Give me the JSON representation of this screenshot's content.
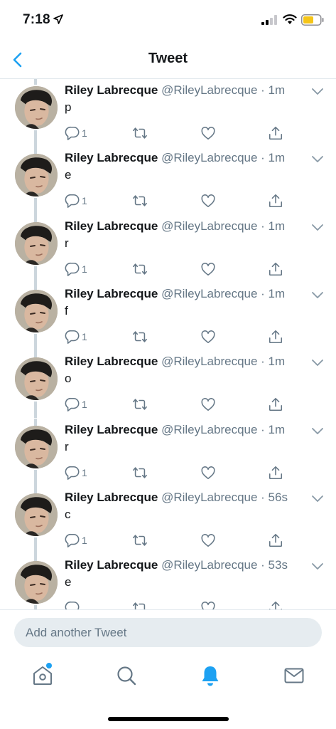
{
  "status_bar": {
    "time": "7:18",
    "icons": [
      "location-arrow-icon",
      "signal-icon",
      "wifi-icon",
      "battery-icon"
    ]
  },
  "header": {
    "title": "Tweet",
    "back_icon": "chevron-left-icon"
  },
  "colors": {
    "accent": "#1da1f2",
    "text_primary": "#14171a",
    "text_secondary": "#657786",
    "divider": "#e1e8ed",
    "thread_line": "#ccd6dd",
    "composer_bg": "#e6ecf0",
    "battery": "#f5c518"
  },
  "tweets": [
    {
      "name": "Riley Labrecque",
      "meta": "@RileyLabrecque · 1m",
      "text": "p",
      "reply_count": "1"
    },
    {
      "name": "Riley Labrecque",
      "meta": "@RileyLabrecque · 1m",
      "text": "e",
      "reply_count": "1"
    },
    {
      "name": "Riley Labrecque",
      "meta": "@RileyLabrecque · 1m",
      "text": "r",
      "reply_count": "1"
    },
    {
      "name": "Riley Labrecque",
      "meta": "@RileyLabrecque · 1m",
      "text": "f",
      "reply_count": "1"
    },
    {
      "name": "Riley Labrecque",
      "meta": "@RileyLabrecque · 1m",
      "text": "o",
      "reply_count": "1"
    },
    {
      "name": "Riley Labrecque",
      "meta": "@RileyLabrecque · 1m",
      "text": "r",
      "reply_count": "1"
    },
    {
      "name": "Riley Labrecque",
      "meta": "@RileyLabrecque · 56s",
      "text": "c",
      "reply_count": "1"
    },
    {
      "name": "Riley Labrecque",
      "meta": "@RileyLabrecque · 53s",
      "text": "e",
      "reply_count": ""
    }
  ],
  "tweet_action_icons": [
    "reply-icon",
    "retweet-icon",
    "like-icon",
    "share-icon"
  ],
  "composer": {
    "placeholder": "Add another Tweet"
  },
  "tabbar": {
    "items": [
      {
        "icon": "home-icon",
        "active": false,
        "has_notification_dot": true
      },
      {
        "icon": "search-icon",
        "active": false
      },
      {
        "icon": "notifications-bell-icon",
        "active": true
      },
      {
        "icon": "messages-envelope-icon",
        "active": false
      }
    ]
  }
}
